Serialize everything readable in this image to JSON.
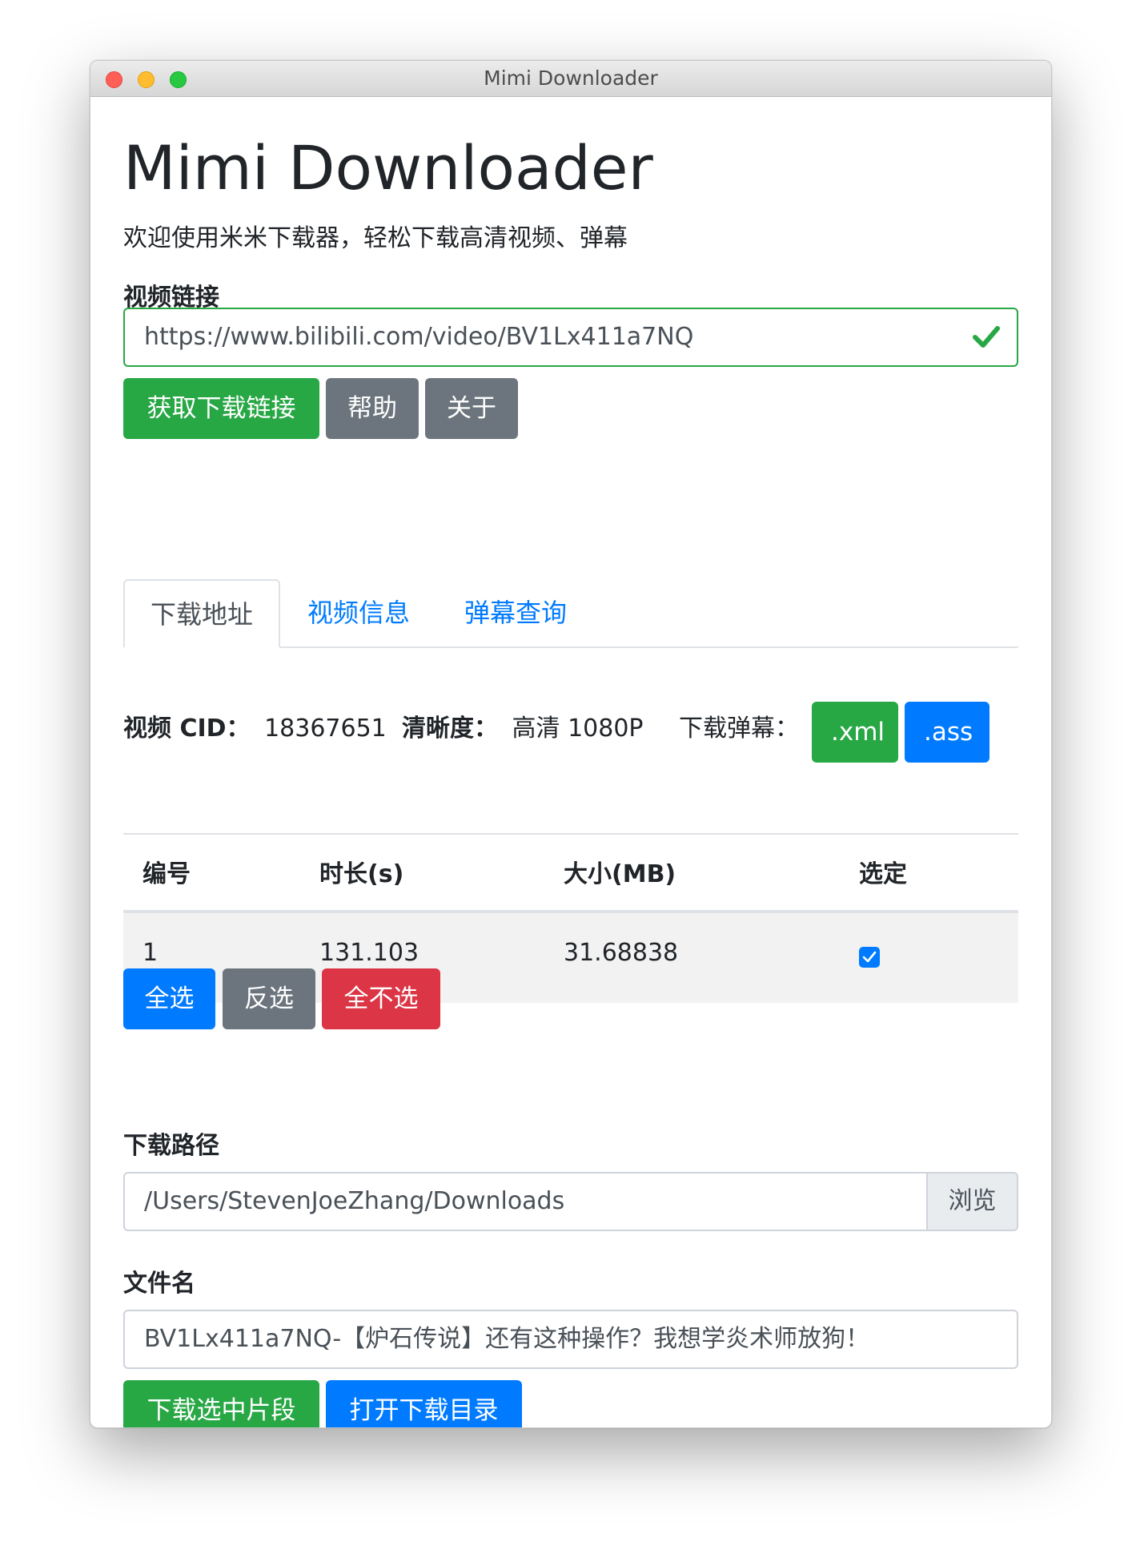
{
  "window": {
    "title": "Mimi Downloader"
  },
  "header": {
    "title": "Mimi Downloader",
    "subtitle": "欢迎使用米米下载器，轻松下载高清视频、弹幕"
  },
  "url_field": {
    "label": "视频链接",
    "value": "https://www.bilibili.com/video/BV1Lx411a7NQ"
  },
  "actions": {
    "get_link": "获取下载链接",
    "help": "帮助",
    "about": "关于"
  },
  "tabs": [
    {
      "label": "下载地址",
      "active": true
    },
    {
      "label": "视频信息",
      "active": false
    },
    {
      "label": "弹幕查询",
      "active": false
    }
  ],
  "info": {
    "cid_label": "视频 CID：",
    "cid_value": "18367651",
    "quality_label": "清晰度：",
    "quality_value": "高清 1080P",
    "danmaku_label": "下载弹幕：",
    "xml_button": ".xml",
    "ass_button": ".ass"
  },
  "table": {
    "headers": [
      "编号",
      "时长(s)",
      "大小(MB)",
      "选定"
    ],
    "rows": [
      {
        "index": "1",
        "duration": "131.103",
        "size": "31.68838",
        "selected": true
      }
    ]
  },
  "selection": {
    "select_all": "全选",
    "invert": "反选",
    "select_none": "全不选"
  },
  "download_path": {
    "label": "下载路径",
    "value": "/Users/StevenJoeZhang/Downloads",
    "browse": "浏览"
  },
  "filename": {
    "label": "文件名",
    "value": "BV1Lx411a7NQ-【炉石传说】还有这种操作？我想学炎术师放狗！"
  },
  "bottom_actions": {
    "download_selected": "下载选中片段",
    "open_dir": "打开下载目录"
  },
  "colors": {
    "success": "#28a745",
    "secondary": "#6c757d",
    "primary": "#007bff",
    "danger": "#dc3545"
  }
}
